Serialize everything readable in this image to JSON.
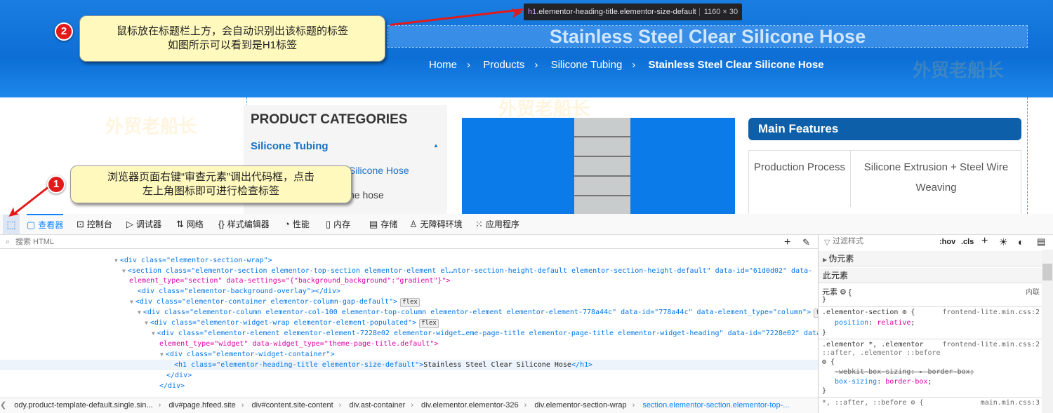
{
  "page": {
    "title": "Stainless Steel Clear Silicone Hose",
    "breadcrumb": [
      "Home",
      "Products",
      "Silicone Tubing",
      "Stainless Steel Clear Silicone Hose"
    ],
    "breadcrumb_sep": "›",
    "sidebar": {
      "title": "PRODUCT CATEGORIES",
      "active": "Silicone Tubing",
      "items": [
        "Silicone Hose",
        "he hose"
      ]
    },
    "features": {
      "title": "Main Features",
      "rows": [
        {
          "label": "Production Process",
          "value": "Silicone Extrusion + Steel Wire Weaving"
        }
      ]
    },
    "watermark": "外贸老船长"
  },
  "inspector_tooltip": {
    "selector_tag": "h1",
    "selector_class": ".elementor-heading-title.elementor-size-default",
    "size": "1160 × 30"
  },
  "annotations": [
    {
      "number": "1",
      "text_line1": "浏览器页面右键“审查元素”调出代码框，点击",
      "text_line2": "左上角图标即可进行检查标签"
    },
    {
      "number": "2",
      "text_line1": "鼠标放在标题栏上方，会自动识别出该标题的标签",
      "text_line2": "如图所示可以看到是H1标签"
    }
  ],
  "devtools": {
    "tabs": [
      "查看器",
      "控制台",
      "调试器",
      "网络",
      "样式编辑器",
      "性能",
      "内存",
      "存储",
      "无障碍环境",
      "应用程序"
    ],
    "active_tab": "查看器",
    "search_placeholder": "搜索 HTML",
    "filter_placeholder": "过滤样式",
    "hov": ":hov",
    "cls": ".cls",
    "pseudo_section": "伪元素",
    "this_element": "此元素",
    "element_rule": "元素",
    "inline": "内联",
    "rules": [
      {
        "selector": ".elementor-section",
        "source": "frontend-lite.min.css:2",
        "decls": [
          {
            "prop": "position",
            "val": "relative"
          }
        ]
      },
      {
        "selector": ".elementor *, .elementor",
        "selector2": "::after, .elementor ::before",
        "source": "frontend-lite.min.css:2",
        "overridden": "-webkit-box-sizing: ▸ border-box;",
        "decls": [
          {
            "prop": "box-sizing",
            "val": "border-box"
          }
        ]
      },
      {
        "selector": "*, ::after, ::before",
        "source": "main.min.css:3"
      }
    ],
    "code": {
      "l1": "<div class=\"elementor-section-wrap\">",
      "l2a": "<section class=\"elementor-section elementor-top-section elementor-element el…ntor-section-height-default elementor-section-height-default\" data-id=\"61d0d02\" data-",
      "l2b": "element_type=\"section\" data-settings=\"{\"background_background\":\"gradient\"}\">",
      "l3": "<div class=\"elementor-background-overlay\"></div>",
      "l4": "<div class=\"elementor-container elementor-column-gap-default\">",
      "l5": "<div class=\"elementor-column elementor-col-100 elementor-top-column elementor-element elementor-element-778a44c\" data-id=\"778a44c\" data-element_type=\"column\">",
      "l6": "<div class=\"elementor-widget-wrap elementor-element-populated\">",
      "l7a": "<div class=\"elementor-element elementor-element-7228e02 elementor-widget…eme-page-title elementor-page-title elementor-widget-heading\" data-id=\"7228e02\" data-",
      "l7b": "element_type=\"widget\" data-widget_type=\"theme-page-title.default\">",
      "l8": "<div class=\"elementor-widget-container\">",
      "l9_tag": "<h1 class=\"elementor-heading-title elementor-size-default\">",
      "l9_text": "Stainless Steel Clear Silicone Hose",
      "l9_close": "</h1>",
      "l10": "</div>",
      "l11": "</div>",
      "flex": "flex"
    },
    "dom_breadcrumb": [
      "ody.product-template-default.single.sin...",
      "div#page.hfeed.site",
      "div#content.site-content",
      "div.ast-container",
      "div.elementor.elementor-326",
      "div.elementor-section-wrap",
      "section.elementor-section.elementor-top-..."
    ]
  },
  "colors": {
    "accent": "#0a84ff",
    "banner": "#0d6fd6",
    "annotation_bg": "#fff9bd",
    "badge": "#e31a1a"
  }
}
